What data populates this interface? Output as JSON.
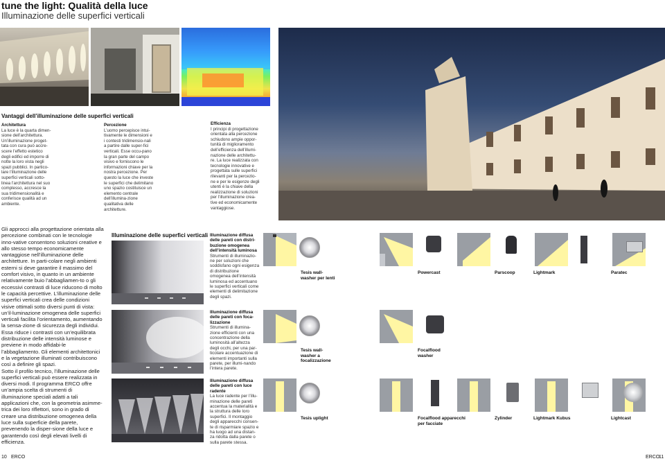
{
  "header": {
    "title": "tune the light: Qualità della luce",
    "subtitle": "Illuminazione delle superfici verticali"
  },
  "top_section": {
    "heading": "Vantaggi dell’illuminazione delle superfici verticali",
    "architettura": {
      "heading": "Architettura",
      "text": "La luce è la quarta dimen-sione dell’architettura. Un’illuminazione proget-tata con cura può accre-scere l’effetto estetico degli edifici ed imporre di notte la loro vista negli spazi pubblici. In partico-lare l’illuminazione delle superfici verticali sotto-linea l’architettura nel suo complesso, accresce la sua tridimensionalità e conferisce qualità ad un ambiente."
    },
    "percezione": {
      "heading": "Percezione",
      "text": "L’uomo percepisce intui-tivamente le dimensioni e i contesti tridimensio-nali a partire dalle super-fici verticali. Esse occu-pano la gran parte del campo visivo e forniscono le informazioni chiave per la nostra percezione. Per questo la luce che investe le superfici che delimitano uno spazio costituisce un elemento centrale dell’illumina-zione qualitativa delle architetture."
    },
    "efficienza": {
      "heading": "Efficienza",
      "text": "I principi di progettazione orientata alla percezione schiudono ampie oppor-tunità di miglioramento dell’efficienza dell’illumi-nazione delle architettu-re. La luce realizzata con tecnologie innovative e progettata sulle superfici rilevanti per la percezio-ne e per le esigenze degli utenti è la chiave della realizzazione di soluzioni per l’illuminazione crea-tive ed economicamente vantaggiose."
    }
  },
  "body_text": "Gli approcci alla progettazione orientata alla percezione combinati con le tecnologie inno-vative consentono soluzioni creative e allo stesso tempo economicamente vantaggiose nell’illuminazione delle architetture. In parti-colare negli ambienti esterni si deve garantire il massimo del comfort visivo, in quanto in un ambiente relativamente buio l’abbagliamen-to o gli eccessivi contrasti di luce riducono di molto le capacità percettive. L’illuminazione delle superfici verticali crea delle condizioni visive ottimali sotto diversi punti di vista: un’il-luminazione omogenea delle superfici verticali facilita l’orientamento, aumentando la sensa-zione di sicurezza degli individui. Essa riduce i contrasti con un’equilibrata distribuzione delle intensità luminose e previene in modo affidabi-le l’abbagliamento. Gli elementi architettonici e la vegetazione illuminati contribuiscono così a definire gli spazi.\n   Sotto il profilo tecnico, l’illuminazione delle superfici verticali può essere realizzata in diversi modi. Il programma ERCO offre un’ampia scelta di strumenti di illuminazione speciali adatti a tali applicazioni che, con la geometria asimme-trica dei loro riflettori, sono in grado di creare una distribuzione omogenea della luce sulla superficie della parete, prevenendo la disper-sione della luce e garantendo così degli elevati livelli di efficienza.",
  "table_heading": "Illuminazione delle superfici verticali",
  "rows": [
    {
      "desc_heading": "Illuminazione diffusa delle pareti con distri-buzione omogenea dell’intensità luminosa",
      "desc_text": "Strumenti di illuminazio-ne per soluzioni che soddisfano ogni esigenza di distribuzione omogenea dell’intensità luminosa ed accentuano le superfici verticali come elementi di delimitazione degli spazi.",
      "product_main": "Tesis wall-washer per lenti",
      "products": [
        "Powercast",
        "Parscoop",
        "Lightmark",
        "Paratec"
      ]
    },
    {
      "desc_heading": "Illuminazione diffusa delle pareti con foca-lizzazione",
      "desc_text": "Strumenti di illumina-zione efficienti con una concentrazione della luminosità all’altezza degli occhi, per una par-ticolare accentuazione di elementi importanti sulla parete, per illumi-nando l’intera parete.",
      "product_main": "Tesis wall-washer a focalizzazione",
      "products": [
        "Focalflood washer"
      ]
    },
    {
      "desc_heading": "Illuminazione diffusa delle pareti con luce radente",
      "desc_text": "La luce radente per l’illu-minazione delle pareti accentua la materialità e la struttura delle loro superfici. Il montaggio degli apparecchi consen-te di risparmiare spazio e ha luogo ad una distan-za ridotta dalla parete o sulla parete stessa.",
      "product_main": "Tesis uplight",
      "products": [
        "Focalflood apparecchi per facciate",
        "Zylinder",
        "Lightmark Kubus",
        "Lightcast"
      ]
    }
  ],
  "footer": {
    "left_page": "10",
    "left_brand": "ERCO",
    "right_brand": "ERCO",
    "right_page": "11"
  },
  "icons": [
    "wall-washer-diagram-icon",
    "downlight-icon",
    "floodlight-icon",
    "bollard-icon",
    "recessed-luminaire-icon",
    "cylinder-icon"
  ]
}
